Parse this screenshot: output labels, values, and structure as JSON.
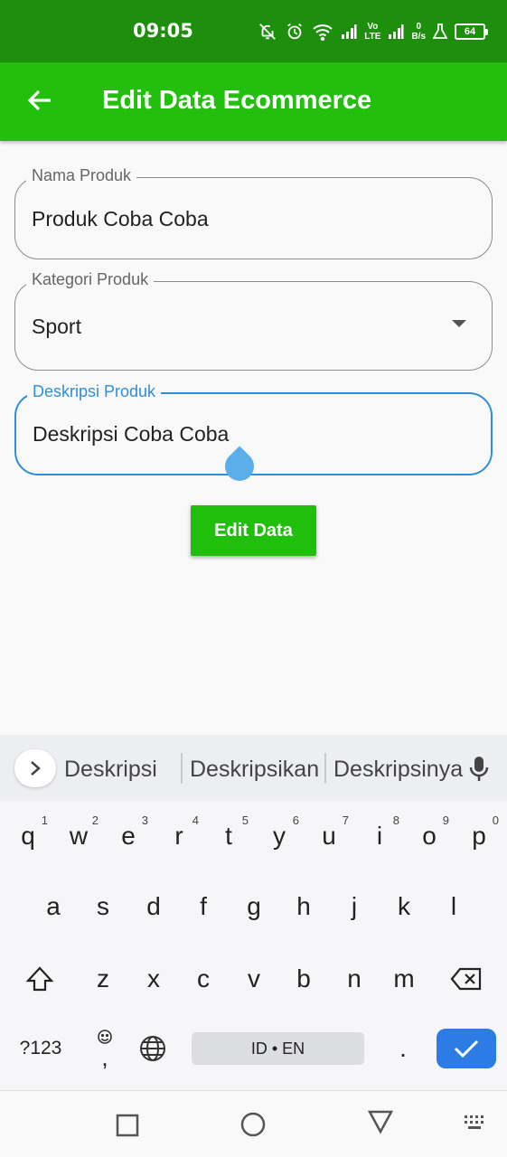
{
  "status_bar": {
    "time": "09:05",
    "network_top": "Vo",
    "network_bottom": "LTE",
    "speed_value": "0",
    "speed_unit": "B/s",
    "battery": "64"
  },
  "app_bar": {
    "title": "Edit Data Ecommerce",
    "back_icon": "arrow-left-icon"
  },
  "form": {
    "product_name": {
      "label": "Nama Produk",
      "value": "Produk Coba Coba"
    },
    "category": {
      "label": "Kategori Produk",
      "value": "Sport"
    },
    "description": {
      "label": "Deskripsi Produk",
      "value": "Deskripsi Coba Coba"
    },
    "submit_label": "Edit Data"
  },
  "keyboard": {
    "suggestions": [
      "Deskripsi",
      "Deskripsikan",
      "Deskripsinya"
    ],
    "row1": [
      {
        "key": "q",
        "hint": "1"
      },
      {
        "key": "w",
        "hint": "2"
      },
      {
        "key": "e",
        "hint": "3"
      },
      {
        "key": "r",
        "hint": "4"
      },
      {
        "key": "t",
        "hint": "5"
      },
      {
        "key": "y",
        "hint": "6"
      },
      {
        "key": "u",
        "hint": "7"
      },
      {
        "key": "i",
        "hint": "8"
      },
      {
        "key": "o",
        "hint": "9"
      },
      {
        "key": "p",
        "hint": "0"
      }
    ],
    "row2": [
      "a",
      "s",
      "d",
      "f",
      "g",
      "h",
      "j",
      "k",
      "l"
    ],
    "row3": [
      "z",
      "x",
      "c",
      "v",
      "b",
      "n",
      "m"
    ],
    "symbols_label": "?123",
    "space_label": "ID • EN",
    "period_label": ".",
    "comma_label": ","
  },
  "colors": {
    "status_bar": "#1e8f0d",
    "app_bar": "#22c00d",
    "button": "#1fbf0c",
    "focus": "#2e8fd8",
    "enter_key": "#2d7ce6"
  }
}
